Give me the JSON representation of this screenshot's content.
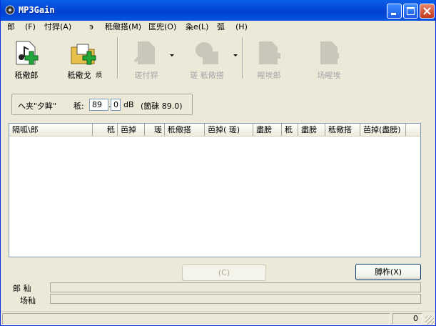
{
  "window": {
    "title": "MP3Gain"
  },
  "menu": [
    {
      "label": "郎"
    },
    {
      "label": "(F)"
    },
    {
      "label": "忖猂(A)"
    },
    {
      "label": "э"
    },
    {
      "label": "秪儆搭(M)"
    },
    {
      "label": "匡兜(O)"
    },
    {
      "label": "粂e(L)"
    },
    {
      "label": "弧"
    },
    {
      "label": "(H)"
    }
  ],
  "toolbar": {
    "add_file": "秪儆郎",
    "add_folder": "秪儆戈",
    "add_folder_suffix": "烦",
    "analyze": "瑳忖猂",
    "track_gain": "瑳   秪儆搭",
    "clear_file": "睲埃郎",
    "clear_all": "场睲埃"
  },
  "volume": {
    "label": "へ夹\"夕眸\"",
    "level_label": "秪:",
    "int_value": "89",
    "dec_value": "0",
    "unit": "dB",
    "default_note": "(箇砞 89.0)"
  },
  "columns": [
    "隔呱\\郎",
    "秪",
    "芭掉",
    "瑳",
    "秪儆搭",
    "芭掉(  瑳)",
    "盡膀",
    "秪",
    "盡膀",
    "秪儆搭",
    "芭掉(盡膀)"
  ],
  "buttons": {
    "cancel": "(C)",
    "exit": "膊柞(X)"
  },
  "progress": {
    "file_label": "郎  秈",
    "total_label": "场秈"
  },
  "status": {
    "count": "0"
  }
}
